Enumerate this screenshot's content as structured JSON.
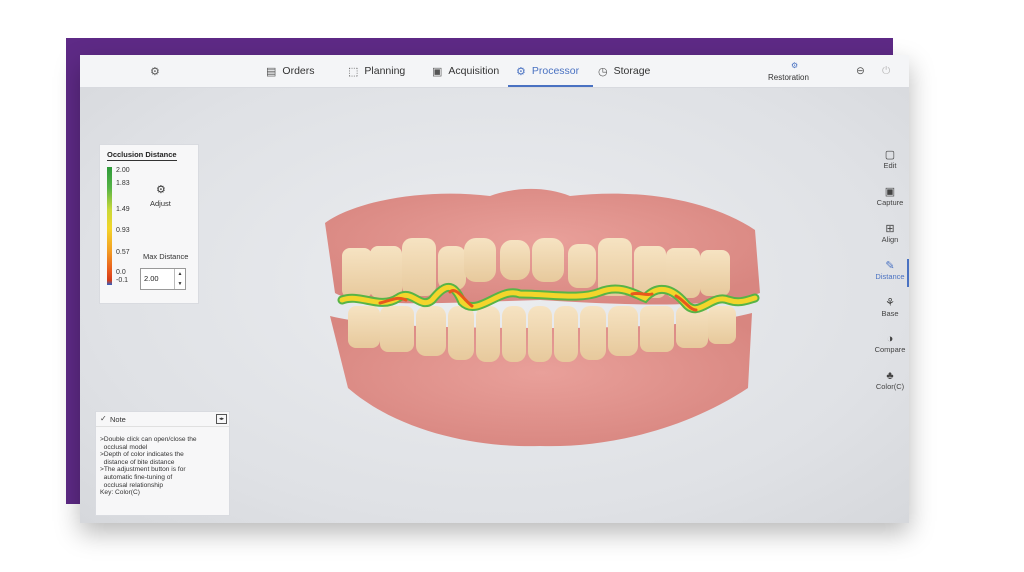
{
  "topbar": {
    "tabs": [
      {
        "label": "Orders",
        "icon": "orders-icon"
      },
      {
        "label": "Planning",
        "icon": "planning-icon"
      },
      {
        "label": "Acquisition",
        "icon": "acquisition-icon"
      },
      {
        "label": "Processor",
        "icon": "processor-icon"
      },
      {
        "label": "Storage",
        "icon": "storage-icon"
      }
    ],
    "active_tab": "Processor",
    "restoration_label": "Restoration"
  },
  "legend": {
    "title": "Occlusion Distance",
    "ticks": [
      "2.00",
      "1.83",
      "1.49",
      "0.93",
      "0.57",
      "0.0",
      "-0.1"
    ],
    "adjust_label": "Adjust",
    "max_distance_label": "Max Distance",
    "max_distance_value": "2.00"
  },
  "tools": [
    {
      "label": "Edit",
      "icon": "edit-icon"
    },
    {
      "label": "Capture",
      "icon": "capture-icon"
    },
    {
      "label": "Align",
      "icon": "align-icon"
    },
    {
      "label": "Distance",
      "icon": "distance-icon"
    },
    {
      "label": "Base",
      "icon": "base-icon"
    },
    {
      "label": "Compare",
      "icon": "compare-icon"
    },
    {
      "label": "Color(C)",
      "icon": "color-icon"
    }
  ],
  "active_tool": "Distance",
  "note": {
    "title": "Note",
    "lines": [
      ">Double click can open/close the\n  occlusal model",
      ">Depth of color indicates the\n  distance of bite distance",
      ">The adjustment button is for\n  automatic fine-tuning of\n  occlusal relationship",
      "Key: Color(C)"
    ]
  },
  "colors": {
    "accent": "#4a72c2",
    "frame": "#5e2a86"
  }
}
